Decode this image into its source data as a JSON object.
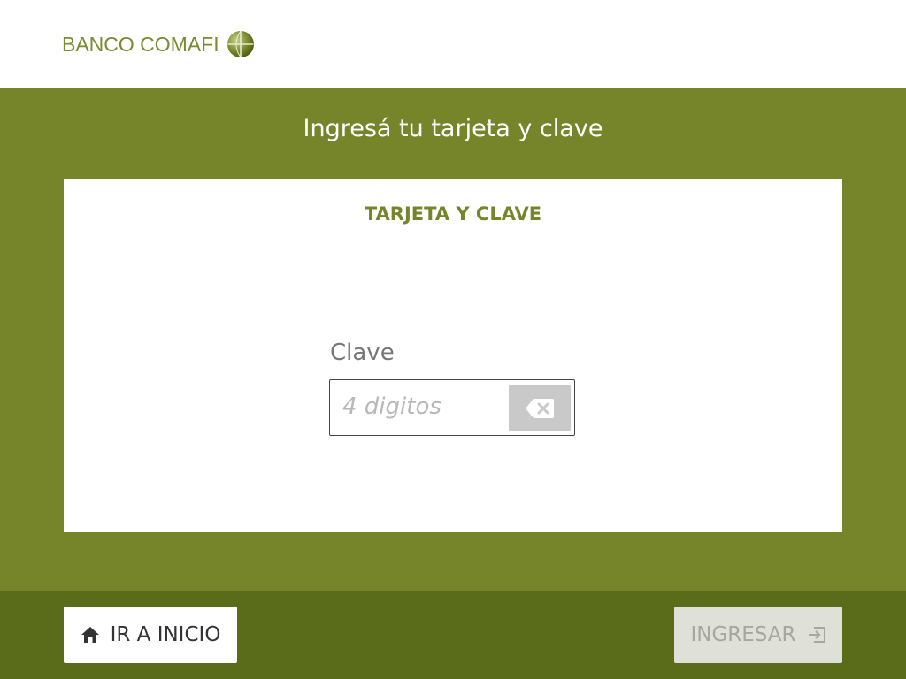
{
  "brand": {
    "name": "BANCO COMAFI",
    "logo_icon": "globe-logo-icon",
    "color": "#7a8a2e"
  },
  "main": {
    "title": "Ingresá tu tarjeta y clave",
    "background": "#76842a"
  },
  "card": {
    "title": "TARJETA Y CLAVE",
    "pin_field": {
      "label": "Clave",
      "value": "",
      "placeholder": "4 digitos",
      "clear_icon": "backspace-icon"
    }
  },
  "footer": {
    "background": "#5a6b1a",
    "home_button": {
      "label": "IR A INICIO",
      "icon": "home-icon"
    },
    "submit_button": {
      "label": "INGRESAR",
      "icon": "login-icon",
      "enabled": false
    }
  }
}
